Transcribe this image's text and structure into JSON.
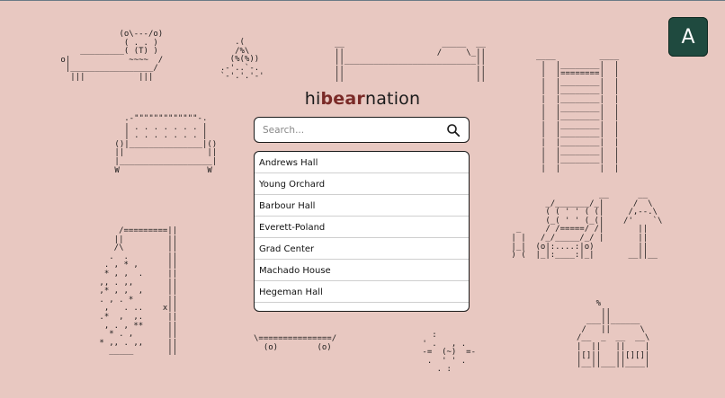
{
  "app": {
    "logo_prefix": "hi",
    "logo_highlight": "bear",
    "logo_suffix": "nation",
    "avatar_initial": "A",
    "accent_color": "#7a2a27",
    "avatar_color": "#1f4a3f"
  },
  "search": {
    "placeholder": "Search...",
    "icon": "search-icon"
  },
  "results": [
    "Andrews Hall",
    "Young Orchard",
    "Barbour Hall",
    "Everett-Poland",
    "Grad Center",
    "Machado House",
    "Hegeman Hall"
  ]
}
